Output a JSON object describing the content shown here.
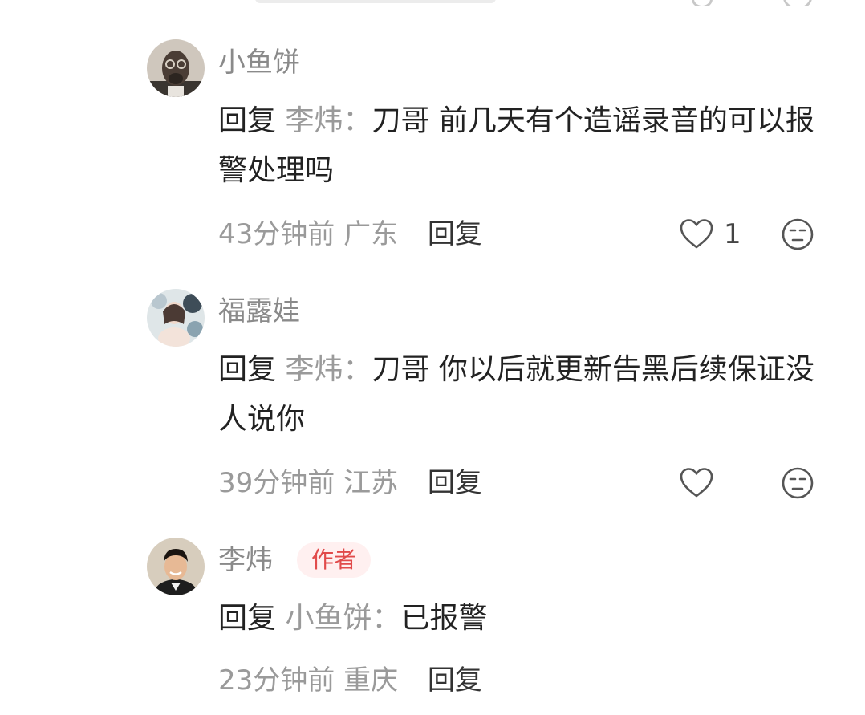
{
  "comments": [
    {
      "username": "小鱼饼",
      "reply_label": "回复",
      "reply_to": "李炜：",
      "text": "刀哥 前几天有个造谣录音的可以报警处理吗",
      "time": "43分钟前",
      "location": "广东",
      "reply_button": "回复",
      "like_count": "1"
    },
    {
      "username": "福露娃",
      "reply_label": "回复",
      "reply_to": "李炜：",
      "text": "刀哥 你以后就更新告黑后续保证没人说你",
      "time": "39分钟前",
      "location": "江苏",
      "reply_button": "回复",
      "like_count": ""
    },
    {
      "username": "李炜",
      "author_badge": "作者",
      "reply_label": "回复",
      "reply_to": "小鱼饼：",
      "text": "已报警",
      "time": "23分钟前",
      "location": "重庆",
      "reply_button": "回复",
      "like_count": ""
    }
  ],
  "colors": {
    "username": "#8a8a8a",
    "body_text": "#222222",
    "meta_text": "#9a9a9a",
    "author_badge_bg": "#fff0f0",
    "author_badge_text": "#e14b4b"
  },
  "icons": [
    "heart-outline-icon",
    "dislike-face-icon"
  ]
}
